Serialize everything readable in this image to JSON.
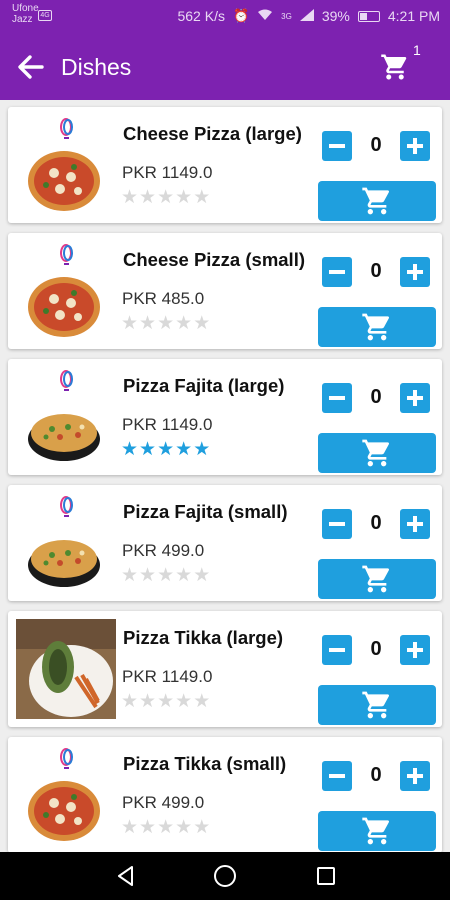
{
  "status_bar": {
    "carrier_line1": "Ufone",
    "carrier_line2": "Jazz",
    "carrier_badge": "4G",
    "net_speed": "562 K/s",
    "signal_label": "3G",
    "battery": "39%",
    "battery_level": 0.39,
    "time": "4:21 PM"
  },
  "app_bar": {
    "title": "Dishes",
    "cart_count": "1",
    "back_icon": "arrow-left-icon",
    "cart_icon": "shopping-cart-icon"
  },
  "dishes": [
    {
      "name": "Cheese Pizza (large)",
      "price": "PKR 1149.0",
      "rating": 0,
      "quantity": "0",
      "image": "pizza-image"
    },
    {
      "name": "Cheese Pizza (small)",
      "price": "PKR 485.0",
      "rating": 0,
      "quantity": "0",
      "image": "pizza-image"
    },
    {
      "name": "Pizza Fajita (large)",
      "price": "PKR 1149.0",
      "rating": 5,
      "quantity": "0",
      "image": "pan-pizza-image"
    },
    {
      "name": "Pizza Fajita (small)",
      "price": "PKR 499.0",
      "rating": 0,
      "quantity": "0",
      "image": "pan-pizza-image"
    },
    {
      "name": "Pizza Tikka (large)",
      "price": "PKR 1149.0",
      "rating": 0,
      "quantity": "0",
      "image": "wrap-plate-photo"
    },
    {
      "name": "Pizza Tikka (small)",
      "price": "PKR 499.0",
      "rating": 0,
      "quantity": "0",
      "image": "pizza-image"
    }
  ],
  "stars_max": 5,
  "colors": {
    "primary": "#7d22b0",
    "accent": "#1f9fde",
    "star_empty": "#d9d9d9",
    "background": "#eeeeee"
  }
}
